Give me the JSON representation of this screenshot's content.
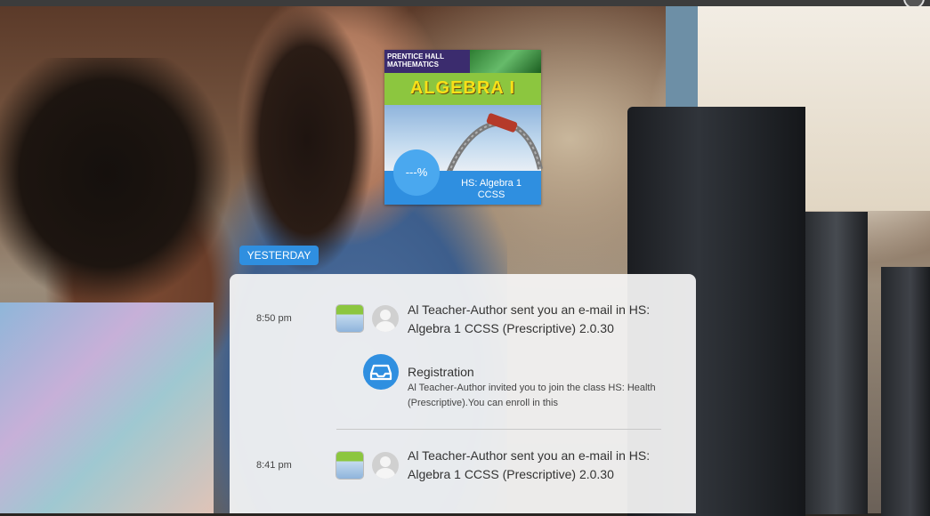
{
  "course": {
    "publisher": "PRENTICE HALL MATHEMATICS",
    "book_title": "ALGEBRA I",
    "name": "HS: Algebra 1 CCSS",
    "progress": "---%"
  },
  "feed": {
    "day_label": "YESTERDAY",
    "items": [
      {
        "time": "8:50 pm",
        "message": "Al Teacher-Author sent you an e-mail in HS: Algebra 1 CCSS (Prescriptive) 2.0.30",
        "notification": {
          "title": "Registration",
          "text": "Al Teacher-Author invited you to join the class HS: Health (Prescriptive).You can enroll in this"
        }
      },
      {
        "time": "8:41 pm",
        "message": "Al Teacher-Author sent you an e-mail in HS: Algebra 1 CCSS (Prescriptive) 2.0.30"
      }
    ]
  },
  "colors": {
    "accent": "#2f8fe0",
    "cover_green": "#8cc63f",
    "cover_purple": "#3b2c6e",
    "cover_title": "#f7e018"
  },
  "icons": {
    "registration": "inbox-tray-icon",
    "sender": "user-avatar-icon"
  }
}
